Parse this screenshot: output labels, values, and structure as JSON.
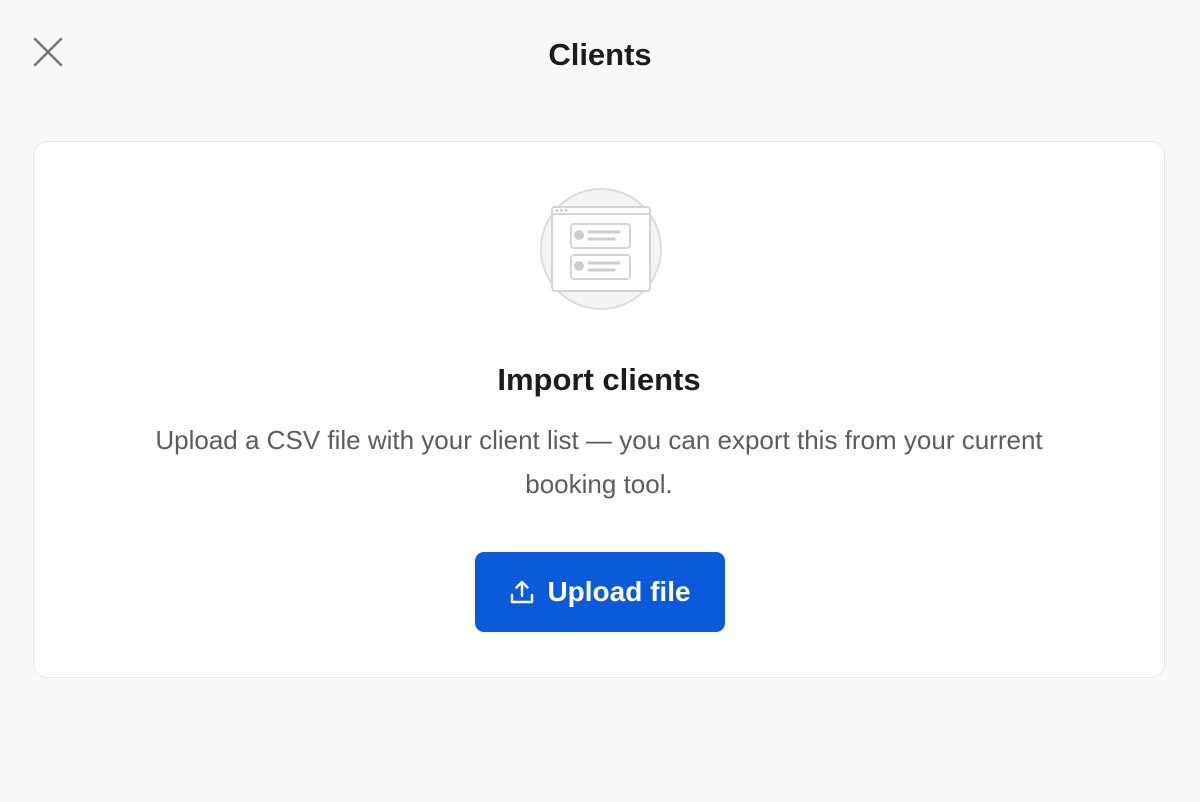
{
  "header": {
    "title": "Clients",
    "close_icon": "close-icon"
  },
  "import_card": {
    "illustration_icon": "client-list-illustration",
    "heading": "Import clients",
    "description": "Upload a CSV file with your client list — you can export this from your current booking tool.",
    "upload_button": {
      "label": "Upload file",
      "icon": "upload-icon"
    }
  },
  "colors": {
    "background": "#f9f9f9",
    "card": "#ffffff",
    "accent": "#0b5ad9",
    "text_primary": "#1c1c1c",
    "text_secondary": "#5c5c5c"
  }
}
